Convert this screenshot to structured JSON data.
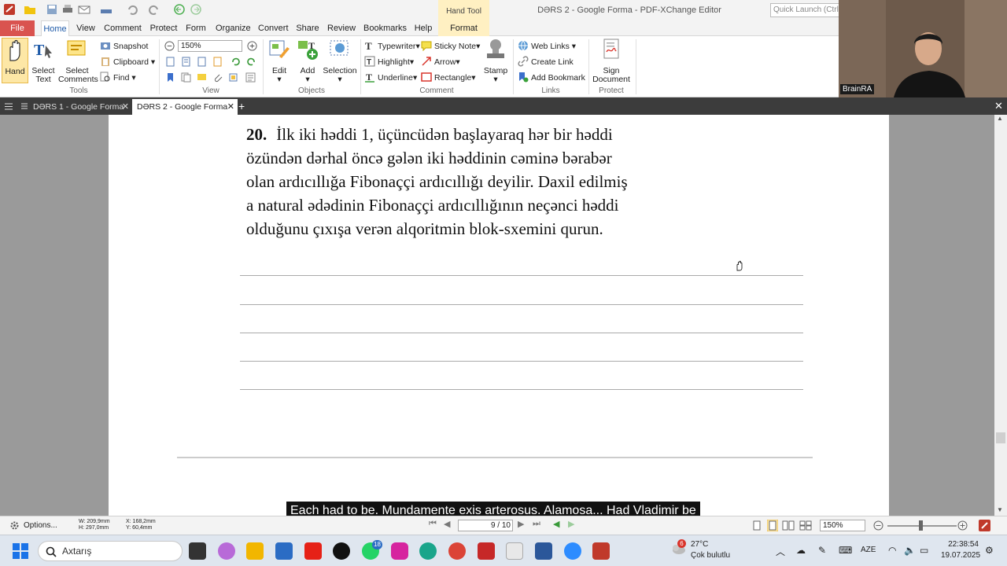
{
  "window": {
    "title": "DƏRS 2 - Google Forma - PDF-XChange Editor",
    "quick_launch_placeholder": "Quick Launch (Ctrl+",
    "context_tab": "Hand Tool"
  },
  "menu": {
    "tabs": [
      "File",
      "Home",
      "View",
      "Comment",
      "Protect",
      "Form",
      "Organize",
      "Convert",
      "Share",
      "Review",
      "Bookmarks",
      "Help",
      "Format"
    ],
    "active": "Home"
  },
  "ribbon": {
    "tools": {
      "hand": "Hand",
      "select_text_1": "Select",
      "select_text_2": "Text",
      "select_comments_1": "Select",
      "select_comments_2": "Comments",
      "label": "Tools"
    },
    "view": {
      "snapshot": "Snapshot",
      "clipboard": "Clipboard",
      "find": "Find",
      "zoom": "150%",
      "label": "View"
    },
    "objects": {
      "edit": "Edit",
      "add": "Add",
      "selection": "Selection",
      "label": "Objects"
    },
    "comment": {
      "typewriter": "Typewriter",
      "highlight": "Highlight",
      "underline": "Underline",
      "sticky_note": "Sticky Note",
      "arrow": "Arrow",
      "rectangle": "Rectangle",
      "stamp": "Stamp",
      "label": "Comment"
    },
    "links": {
      "web_links": "Web Links",
      "create_link": "Create Link",
      "add_bookmark": "Add Bookmark",
      "label": "Links"
    },
    "protect": {
      "sign_1": "Sign",
      "sign_2": "Document",
      "label": "Protect"
    }
  },
  "webcam": {
    "label": "BrainRA"
  },
  "doc_tabs": [
    {
      "label": "DƏRS 1 - Google Forma"
    },
    {
      "label": "DƏRS 2 - Google Forma"
    }
  ],
  "document": {
    "question_number": "20.",
    "question_lines": [
      "İlk iki həddi 1, üçüncüdən başlayaraq hər bir həddi",
      "özündən dərhal öncə gələn iki həddinin cəminə bərabər",
      "olan ardıcıllığa Fibonaççi ardıcıllığı deyilir. Daxil edilmiş",
      "a natural ədədinin Fibonaççi ardıcıllığının neçənci həddi",
      "olduğunu çıxışa verən alqoritmin blok-sxemini qurun."
    ]
  },
  "subtitle": "Each had to be. Mundamente exis arterosus. Alamosa... Had Vladimir be",
  "statusbar": {
    "options": "Options...",
    "width": "W: 209,9mm",
    "height": "H: 297,0mm",
    "x": "X: 168,2mm",
    "y": "Y: 60,4mm",
    "page": "9 / 10",
    "zoom": "150%"
  },
  "taskbar": {
    "search": "Axtarış",
    "weather_temp": "27°C",
    "weather_desc": "Çok bulutlu",
    "weather_badge": "6",
    "lang": "AZE",
    "time": "22:38:54",
    "date": "19.07.2025",
    "whatsapp_badge": "18"
  }
}
